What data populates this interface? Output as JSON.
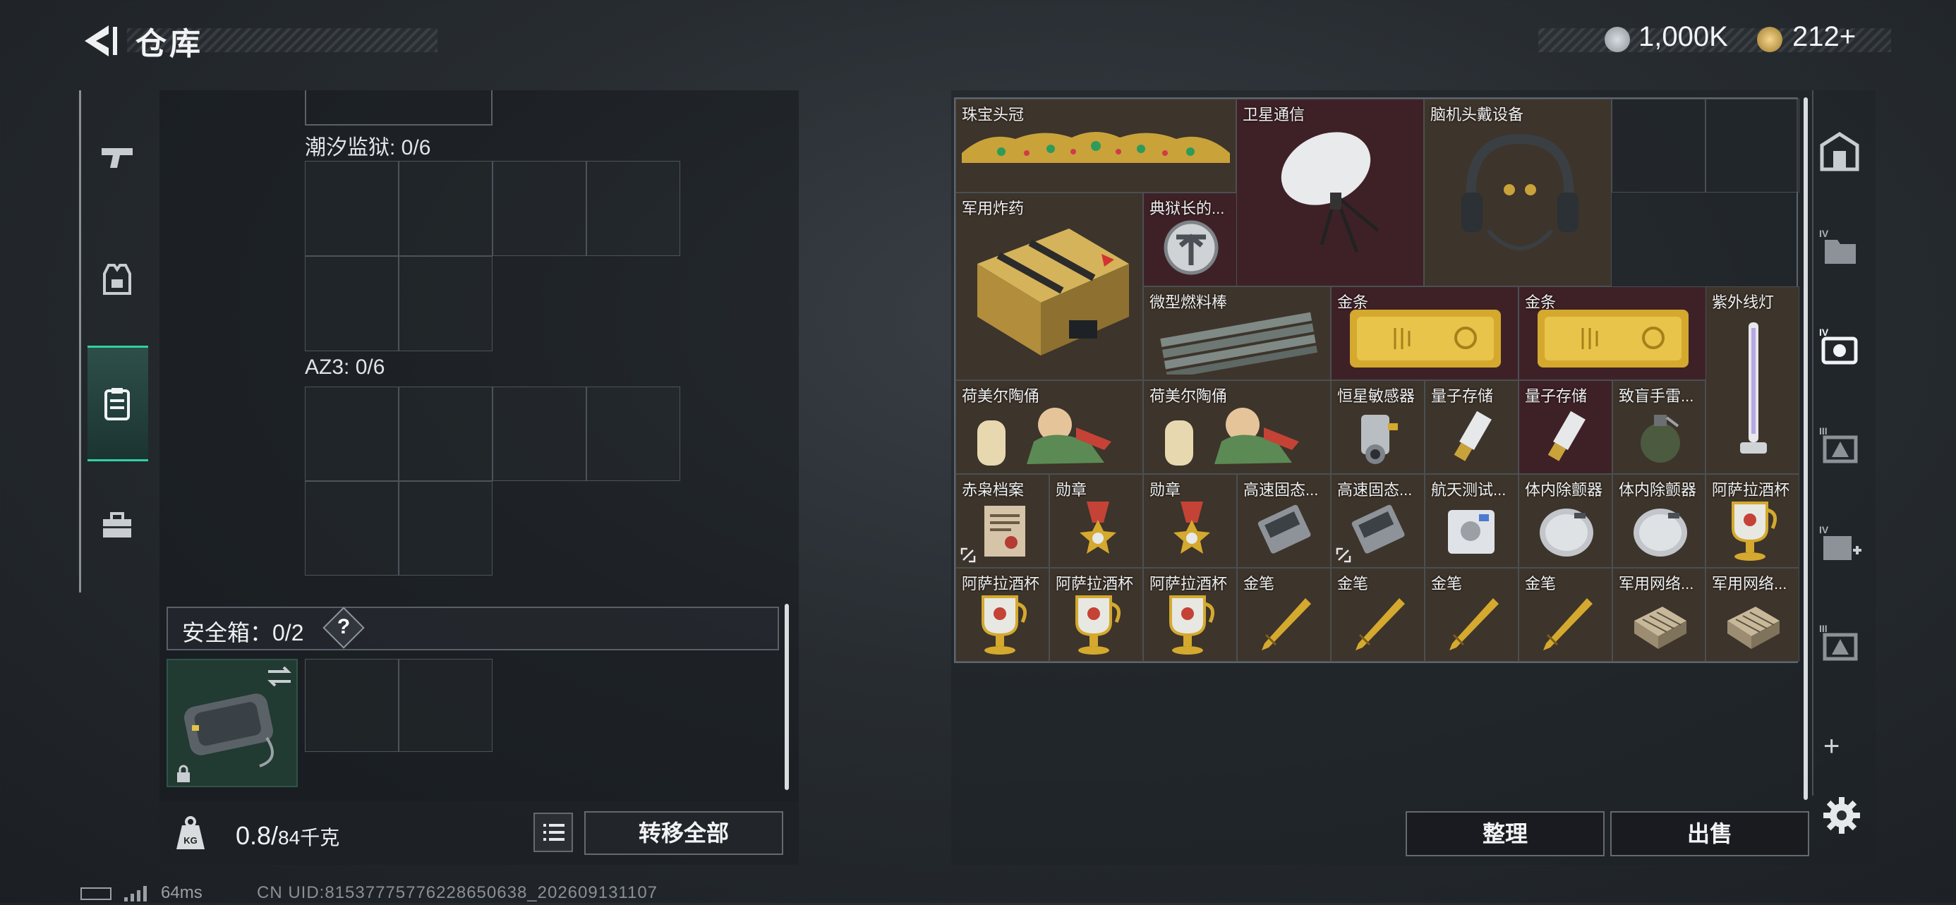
{
  "header": {
    "title": "仓库"
  },
  "currency": [
    {
      "icon": "silver-coin-icon",
      "value": "1,000K"
    },
    {
      "icon": "gold-coin-icon",
      "value": "212+"
    }
  ],
  "left_tabs": [
    {
      "icon": "pistol-icon"
    },
    {
      "icon": "armor-vest-icon"
    },
    {
      "icon": "backpack-icon",
      "active": true
    },
    {
      "icon": "toolbox-icon"
    }
  ],
  "containers": [
    {
      "label": "潮汐监狱: 0/6"
    },
    {
      "label": "AZ3: 0/6"
    }
  ],
  "safe_box": {
    "label": "安全箱：0/2",
    "help": "?"
  },
  "weight": {
    "value": "0.8/",
    "unit": "84千克"
  },
  "buttons": {
    "transfer_all": "转移全部",
    "organize": "整理",
    "sell": "出售"
  },
  "stash_items": [
    {
      "name": "珠宝头冠",
      "icon": "jeweled-crown-icon",
      "rarity": "gold"
    },
    {
      "name": "卫星通信",
      "icon": "satellite-dish-icon",
      "rarity": "red"
    },
    {
      "name": "脑机头戴设备",
      "icon": "headset-device-icon",
      "rarity": "gold"
    },
    {
      "name": "军用炸药",
      "icon": "explosive-crate-icon",
      "rarity": "gold"
    },
    {
      "name": "典狱长的...",
      "icon": "warden-badge-icon",
      "rarity": "red"
    },
    {
      "name": "微型燃料棒",
      "icon": "fuel-rods-icon",
      "rarity": "gold"
    },
    {
      "name": "金条",
      "icon": "gold-bar-icon",
      "rarity": "red"
    },
    {
      "name": "金条",
      "icon": "gold-bar-icon",
      "rarity": "red"
    },
    {
      "name": "紫外线灯",
      "icon": "uv-lamp-icon",
      "rarity": "gold"
    },
    {
      "name": "荷美尔陶俑",
      "icon": "figurine-icon",
      "rarity": "gold"
    },
    {
      "name": "荷美尔陶俑",
      "icon": "figurine-icon",
      "rarity": "gold"
    },
    {
      "name": "恒星敏感器",
      "icon": "star-sensor-icon",
      "rarity": "gold"
    },
    {
      "name": "量子存储",
      "icon": "usb-drive-icon",
      "rarity": "gold"
    },
    {
      "name": "量子存储",
      "icon": "usb-drive-icon",
      "rarity": "red"
    },
    {
      "name": "致盲手雷...",
      "icon": "grenade-icon",
      "rarity": "gold"
    },
    {
      "name": "赤枭档案",
      "icon": "archive-folder-icon",
      "rarity": "gold",
      "marked": true
    },
    {
      "name": "勋章",
      "icon": "medal-icon",
      "rarity": "gold"
    },
    {
      "name": "勋章",
      "icon": "medal-icon",
      "rarity": "gold"
    },
    {
      "name": "高速固态...",
      "icon": "ssd-icon",
      "rarity": "gold"
    },
    {
      "name": "高速固态...",
      "icon": "ssd-icon",
      "rarity": "gold",
      "marked": true
    },
    {
      "name": "航天测试...",
      "icon": "test-device-icon",
      "rarity": "gold"
    },
    {
      "name": "体内除颤器",
      "icon": "defibrillator-icon",
      "rarity": "gold"
    },
    {
      "name": "体内除颤器",
      "icon": "defibrillator-icon",
      "rarity": "gold"
    },
    {
      "name": "阿萨拉酒杯",
      "icon": "goblet-icon",
      "rarity": "gold"
    },
    {
      "name": "阿萨拉酒杯",
      "icon": "goblet-icon",
      "rarity": "gold"
    },
    {
      "name": "阿萨拉酒杯",
      "icon": "goblet-icon",
      "rarity": "gold"
    },
    {
      "name": "阿萨拉酒杯",
      "icon": "goblet-icon",
      "rarity": "gold"
    },
    {
      "name": "金笔",
      "icon": "gold-pen-icon",
      "rarity": "gold"
    },
    {
      "name": "金笔",
      "icon": "gold-pen-icon",
      "rarity": "gold"
    },
    {
      "name": "金笔",
      "icon": "gold-pen-icon",
      "rarity": "gold"
    },
    {
      "name": "金笔",
      "icon": "gold-pen-icon",
      "rarity": "gold"
    },
    {
      "name": "军用网络...",
      "icon": "network-module-icon",
      "rarity": "gold"
    },
    {
      "name": "军用网络...",
      "icon": "network-module-icon",
      "rarity": "gold"
    }
  ],
  "right_tabs": [
    {
      "icon": "stash-home-icon"
    },
    {
      "icon": "stash-iv-folder-icon"
    },
    {
      "icon": "stash-iv-camera-icon"
    },
    {
      "icon": "stash-iii-warning-icon"
    },
    {
      "icon": "stash-iv-plus-icon"
    },
    {
      "icon": "stash-iii-warning-icon"
    }
  ],
  "footer": {
    "ping": "64ms",
    "uid": "CN UID:8153777577622865063​8_202609131107"
  },
  "colors": {
    "accent": "#2fd0a5",
    "gold_slot": "#3d342b",
    "red_slot": "#3e2127"
  }
}
